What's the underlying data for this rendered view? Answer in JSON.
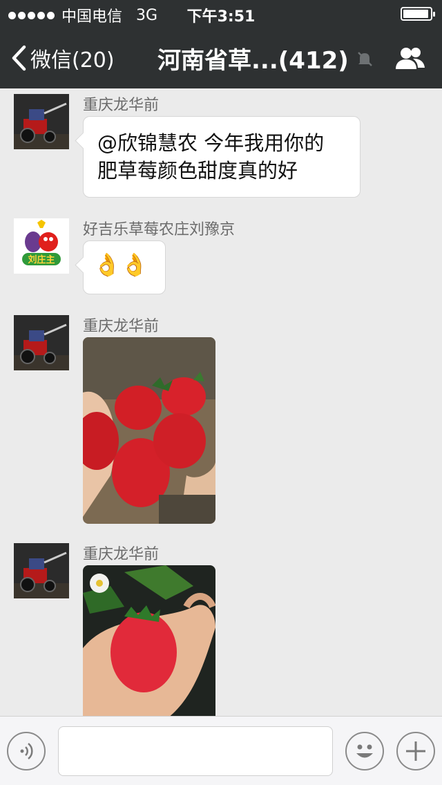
{
  "status_bar": {
    "carrier": "中国电信",
    "network": "3G",
    "time": "下午3:51",
    "battery_icon": "battery-icon"
  },
  "nav": {
    "back_label": "微信(20)",
    "title": "河南省草...(412)",
    "mute_icon": "bell-muted-icon",
    "contacts_icon": "group-icon"
  },
  "messages": [
    {
      "sender": "重庆龙华前",
      "type": "text",
      "text_line1": "@欣锦慧农 今年我用你的",
      "text_line2": "肥草莓颜色甜度真的好"
    },
    {
      "sender": "好吉乐草莓农庄刘豫京",
      "type": "emoji",
      "emoji": "👌👌"
    },
    {
      "sender": "重庆龙华前",
      "type": "image",
      "alt": "strawberries-photo"
    },
    {
      "sender": "重庆龙华前",
      "type": "image",
      "alt": "strawberry-in-hand-photo"
    }
  ],
  "avatar_logo_text": "刘庄主",
  "bottom_bar": {
    "voice_icon": "voice-icon",
    "input_value": "",
    "emoji_icon": "smiley-icon",
    "plus_icon": "plus-icon"
  },
  "colors": {
    "header_bg": "#2e3132",
    "chat_bg": "#ebebeb",
    "bubble_bg": "#ffffff"
  }
}
